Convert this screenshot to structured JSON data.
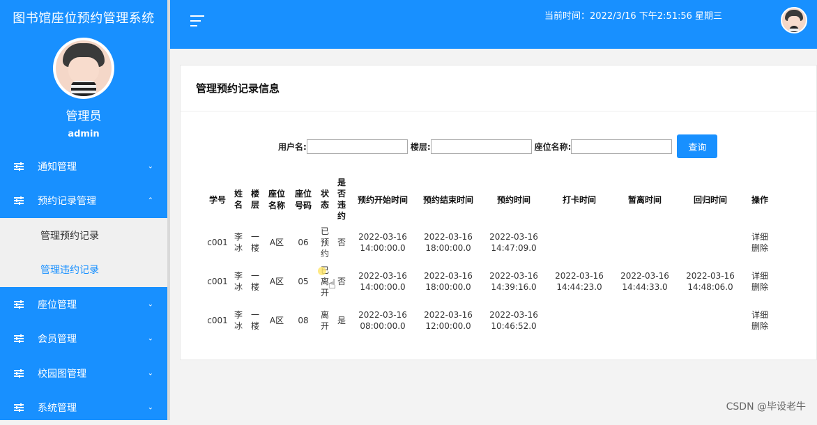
{
  "app": {
    "title": "图书馆座位预约管理系统",
    "role": "管理员",
    "account": "admin"
  },
  "menu": [
    {
      "label": "通知管理",
      "expanded": false
    },
    {
      "label": "预约记录管理",
      "expanded": true,
      "children": [
        {
          "label": "管理预约记录",
          "active": false
        },
        {
          "label": "管理违约记录",
          "active": true
        }
      ]
    },
    {
      "label": "座位管理",
      "expanded": false
    },
    {
      "label": "会员管理",
      "expanded": false
    },
    {
      "label": "校园图管理",
      "expanded": false
    },
    {
      "label": "系统管理",
      "expanded": false
    }
  ],
  "header": {
    "clock": "当前时间：2022/3/16 下午2:51:56 星期三"
  },
  "card": {
    "title": "管理预约记录信息"
  },
  "search": {
    "username_label": "用户名:",
    "floor_label": "楼层:",
    "seat_label": "座位名称:",
    "button": "查询"
  },
  "table": {
    "headers": [
      "学号",
      "姓名",
      "楼层",
      "座位名称",
      "座位号码",
      "状态",
      "是否违约",
      "预约开始时间",
      "预约结束时间",
      "预约时间",
      "打卡时间",
      "暂离时间",
      "回归时间",
      "操作"
    ],
    "rows": [
      {
        "id": "c001",
        "name": "李冰",
        "floor": "一楼",
        "seat_name": "A区",
        "seat_no": "06",
        "status": "已预约",
        "violation": "否",
        "start": "2022-03-16 14:00:00.0",
        "end": "2022-03-16 18:00:00.0",
        "booked": "2022-03-16 14:47:09.0",
        "checkin": "",
        "leave": "",
        "return": "",
        "ops": [
          "详细",
          "删除"
        ]
      },
      {
        "id": "c001",
        "name": "李冰",
        "floor": "一楼",
        "seat_name": "A区",
        "seat_no": "05",
        "status": "已离开",
        "violation": "否",
        "start": "2022-03-16 14:00:00.0",
        "end": "2022-03-16 18:00:00.0",
        "booked": "2022-03-16 14:39:16.0",
        "checkin": "2022-03-16 14:44:23.0",
        "leave": "2022-03-16 14:44:33.0",
        "return": "2022-03-16 14:48:06.0",
        "ops": [
          "详细",
          "删除"
        ]
      },
      {
        "id": "c001",
        "name": "李冰",
        "floor": "一楼",
        "seat_name": "A区",
        "seat_no": "08",
        "status": "离开",
        "violation": "是",
        "start": "2022-03-16 08:00:00.0",
        "end": "2022-03-16 12:00:00.0",
        "booked": "2022-03-16 10:46:52.0",
        "checkin": "",
        "leave": "",
        "return": "",
        "ops": [
          "详细",
          "删除"
        ]
      }
    ]
  },
  "watermark": "CSDN @毕设老牛"
}
